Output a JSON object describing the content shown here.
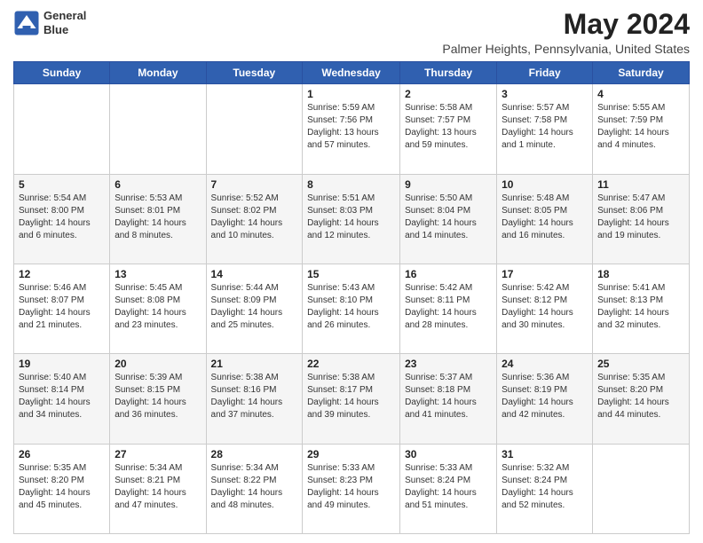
{
  "logo": {
    "line1": "General",
    "line2": "Blue"
  },
  "title": "May 2024",
  "subtitle": "Palmer Heights, Pennsylvania, United States",
  "header": {
    "days": [
      "Sunday",
      "Monday",
      "Tuesday",
      "Wednesday",
      "Thursday",
      "Friday",
      "Saturday"
    ]
  },
  "weeks": [
    [
      {
        "day": "",
        "sunrise": "",
        "sunset": "",
        "daylight": ""
      },
      {
        "day": "",
        "sunrise": "",
        "sunset": "",
        "daylight": ""
      },
      {
        "day": "",
        "sunrise": "",
        "sunset": "",
        "daylight": ""
      },
      {
        "day": "1",
        "sunrise": "Sunrise: 5:59 AM",
        "sunset": "Sunset: 7:56 PM",
        "daylight": "Daylight: 13 hours and 57 minutes."
      },
      {
        "day": "2",
        "sunrise": "Sunrise: 5:58 AM",
        "sunset": "Sunset: 7:57 PM",
        "daylight": "Daylight: 13 hours and 59 minutes."
      },
      {
        "day": "3",
        "sunrise": "Sunrise: 5:57 AM",
        "sunset": "Sunset: 7:58 PM",
        "daylight": "Daylight: 14 hours and 1 minute."
      },
      {
        "day": "4",
        "sunrise": "Sunrise: 5:55 AM",
        "sunset": "Sunset: 7:59 PM",
        "daylight": "Daylight: 14 hours and 4 minutes."
      }
    ],
    [
      {
        "day": "5",
        "sunrise": "Sunrise: 5:54 AM",
        "sunset": "Sunset: 8:00 PM",
        "daylight": "Daylight: 14 hours and 6 minutes."
      },
      {
        "day": "6",
        "sunrise": "Sunrise: 5:53 AM",
        "sunset": "Sunset: 8:01 PM",
        "daylight": "Daylight: 14 hours and 8 minutes."
      },
      {
        "day": "7",
        "sunrise": "Sunrise: 5:52 AM",
        "sunset": "Sunset: 8:02 PM",
        "daylight": "Daylight: 14 hours and 10 minutes."
      },
      {
        "day": "8",
        "sunrise": "Sunrise: 5:51 AM",
        "sunset": "Sunset: 8:03 PM",
        "daylight": "Daylight: 14 hours and 12 minutes."
      },
      {
        "day": "9",
        "sunrise": "Sunrise: 5:50 AM",
        "sunset": "Sunset: 8:04 PM",
        "daylight": "Daylight: 14 hours and 14 minutes."
      },
      {
        "day": "10",
        "sunrise": "Sunrise: 5:48 AM",
        "sunset": "Sunset: 8:05 PM",
        "daylight": "Daylight: 14 hours and 16 minutes."
      },
      {
        "day": "11",
        "sunrise": "Sunrise: 5:47 AM",
        "sunset": "Sunset: 8:06 PM",
        "daylight": "Daylight: 14 hours and 19 minutes."
      }
    ],
    [
      {
        "day": "12",
        "sunrise": "Sunrise: 5:46 AM",
        "sunset": "Sunset: 8:07 PM",
        "daylight": "Daylight: 14 hours and 21 minutes."
      },
      {
        "day": "13",
        "sunrise": "Sunrise: 5:45 AM",
        "sunset": "Sunset: 8:08 PM",
        "daylight": "Daylight: 14 hours and 23 minutes."
      },
      {
        "day": "14",
        "sunrise": "Sunrise: 5:44 AM",
        "sunset": "Sunset: 8:09 PM",
        "daylight": "Daylight: 14 hours and 25 minutes."
      },
      {
        "day": "15",
        "sunrise": "Sunrise: 5:43 AM",
        "sunset": "Sunset: 8:10 PM",
        "daylight": "Daylight: 14 hours and 26 minutes."
      },
      {
        "day": "16",
        "sunrise": "Sunrise: 5:42 AM",
        "sunset": "Sunset: 8:11 PM",
        "daylight": "Daylight: 14 hours and 28 minutes."
      },
      {
        "day": "17",
        "sunrise": "Sunrise: 5:42 AM",
        "sunset": "Sunset: 8:12 PM",
        "daylight": "Daylight: 14 hours and 30 minutes."
      },
      {
        "day": "18",
        "sunrise": "Sunrise: 5:41 AM",
        "sunset": "Sunset: 8:13 PM",
        "daylight": "Daylight: 14 hours and 32 minutes."
      }
    ],
    [
      {
        "day": "19",
        "sunrise": "Sunrise: 5:40 AM",
        "sunset": "Sunset: 8:14 PM",
        "daylight": "Daylight: 14 hours and 34 minutes."
      },
      {
        "day": "20",
        "sunrise": "Sunrise: 5:39 AM",
        "sunset": "Sunset: 8:15 PM",
        "daylight": "Daylight: 14 hours and 36 minutes."
      },
      {
        "day": "21",
        "sunrise": "Sunrise: 5:38 AM",
        "sunset": "Sunset: 8:16 PM",
        "daylight": "Daylight: 14 hours and 37 minutes."
      },
      {
        "day": "22",
        "sunrise": "Sunrise: 5:38 AM",
        "sunset": "Sunset: 8:17 PM",
        "daylight": "Daylight: 14 hours and 39 minutes."
      },
      {
        "day": "23",
        "sunrise": "Sunrise: 5:37 AM",
        "sunset": "Sunset: 8:18 PM",
        "daylight": "Daylight: 14 hours and 41 minutes."
      },
      {
        "day": "24",
        "sunrise": "Sunrise: 5:36 AM",
        "sunset": "Sunset: 8:19 PM",
        "daylight": "Daylight: 14 hours and 42 minutes."
      },
      {
        "day": "25",
        "sunrise": "Sunrise: 5:35 AM",
        "sunset": "Sunset: 8:20 PM",
        "daylight": "Daylight: 14 hours and 44 minutes."
      }
    ],
    [
      {
        "day": "26",
        "sunrise": "Sunrise: 5:35 AM",
        "sunset": "Sunset: 8:20 PM",
        "daylight": "Daylight: 14 hours and 45 minutes."
      },
      {
        "day": "27",
        "sunrise": "Sunrise: 5:34 AM",
        "sunset": "Sunset: 8:21 PM",
        "daylight": "Daylight: 14 hours and 47 minutes."
      },
      {
        "day": "28",
        "sunrise": "Sunrise: 5:34 AM",
        "sunset": "Sunset: 8:22 PM",
        "daylight": "Daylight: 14 hours and 48 minutes."
      },
      {
        "day": "29",
        "sunrise": "Sunrise: 5:33 AM",
        "sunset": "Sunset: 8:23 PM",
        "daylight": "Daylight: 14 hours and 49 minutes."
      },
      {
        "day": "30",
        "sunrise": "Sunrise: 5:33 AM",
        "sunset": "Sunset: 8:24 PM",
        "daylight": "Daylight: 14 hours and 51 minutes."
      },
      {
        "day": "31",
        "sunrise": "Sunrise: 5:32 AM",
        "sunset": "Sunset: 8:24 PM",
        "daylight": "Daylight: 14 hours and 52 minutes."
      },
      {
        "day": "",
        "sunrise": "",
        "sunset": "",
        "daylight": ""
      }
    ]
  ]
}
